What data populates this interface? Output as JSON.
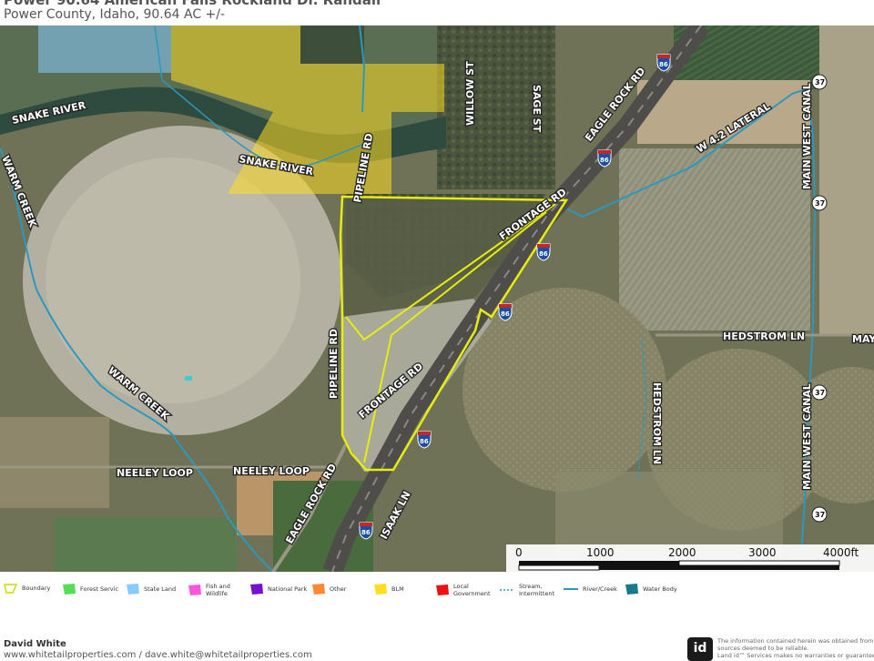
{
  "header": {
    "title": "Power 90.64 American Falls Rockland Dr. Randall",
    "subtitle": "Power County, Idaho, 90.64 AC +/-"
  },
  "map": {
    "labels": {
      "snake_river_1": "SNAKE RIVER",
      "snake_river_2": "SNAKE RIVER",
      "warm_creek_1": "WARM CREEK",
      "warm_creek_2": "WARM CREEK",
      "willow_st": "WILLOW ST",
      "sage_st": "SAGE ST",
      "eagle_rock_rd_1": "EAGLE ROCK RD",
      "eagle_rock_rd_2": "EAGLE ROCK RD",
      "w_lateral": "W 4.2 LATERAL",
      "main_west_canal_1": "MAIN WEST CANAL",
      "main_west_canal_2": "MAIN WEST CANAL",
      "pipeline_rd_1": "PIPELINE RD",
      "pipeline_rd_2": "PIPELINE RD",
      "frontage_rd_1": "FRONTAGE RD",
      "frontage_rd_2": "FRONTAGE RD",
      "hedstrom_ln_1": "HEDSTROM LN",
      "hedstrom_ln_2": "HEDSTROM LN",
      "hedstrom_ln_3": "MAYE",
      "neeley_loop_1": "NEELEY LOOP",
      "neeley_loop_2": "NEELEY LOOP",
      "isaak_ln": "ISAAK LN",
      "interstate": "86",
      "state_route": "37"
    },
    "scale": {
      "ticks": [
        "0",
        "1000",
        "2000",
        "3000",
        "4000ft"
      ]
    }
  },
  "legend": {
    "items": [
      {
        "label": "Boundary",
        "color": "#d4d800"
      },
      {
        "label": "Forest Servic",
        "color": "#55dd55"
      },
      {
        "label": "State Land",
        "color": "#88ccff"
      },
      {
        "label": "Fish and Wildlife",
        "color": "#ff55dd"
      },
      {
        "label": "National Park",
        "color": "#7711cc"
      },
      {
        "label": "Other",
        "color": "#ff8833"
      },
      {
        "label": "BLM",
        "color": "#ffdd22"
      },
      {
        "label": "Local Government",
        "color": "#ee1111"
      },
      {
        "label": "Stream, Intermittent",
        "color": "#2d98bf"
      },
      {
        "label": "River/Creek",
        "color": "#2d98bf"
      },
      {
        "label": "Water Body",
        "color": "#157a8a"
      }
    ]
  },
  "footer": {
    "agent": "David White",
    "contact": "www.whitetailproperties.com / dave.white@whitetailproperties.com",
    "logo_text": "id",
    "disclaimer_1": "The information contained herein was obtained from",
    "disclaimer_2": "sources deemed to be reliable.",
    "disclaimer_3": "Land id™ Services makes no warranties or guarantees"
  }
}
